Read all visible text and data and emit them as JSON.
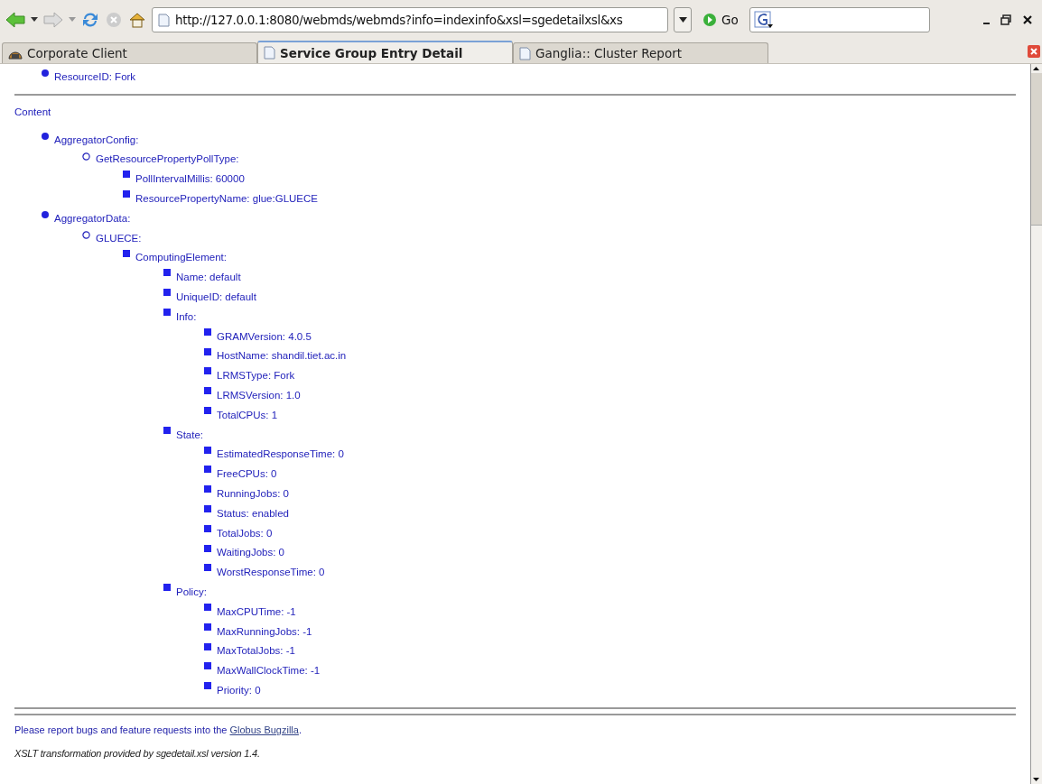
{
  "toolbar": {
    "url": "http://127.0.0.1:8080/webmds/webmds?info=indexinfo&xsl=sgedetailxsl&xs",
    "go": "Go"
  },
  "tabs": [
    {
      "label": "Corporate Client",
      "selected": false
    },
    {
      "label": "Service Group Entry Detail",
      "selected": true
    },
    {
      "label": "Ganglia:: Cluster Report",
      "selected": false
    }
  ],
  "top_items": [
    {
      "text": "ResourceID: Fork"
    }
  ],
  "section_title": "Content",
  "tree": [
    {
      "text": "AggregatorConfig:",
      "children": [
        {
          "text": "GetResourcePropertyPollType:",
          "children": [
            {
              "text": "PollIntervalMillis: 60000"
            },
            {
              "text": "ResourcePropertyName: glue:GLUECE"
            }
          ]
        }
      ]
    },
    {
      "text": "AggregatorData:",
      "children": [
        {
          "text": "GLUECE:",
          "children": [
            {
              "text": "ComputingElement:",
              "children": [
                {
                  "text": "Name: default"
                },
                {
                  "text": "UniqueID: default"
                },
                {
                  "text": "Info:",
                  "children": [
                    {
                      "text": "GRAMVersion: 4.0.5"
                    },
                    {
                      "text": "HostName: shandil.tiet.ac.in"
                    },
                    {
                      "text": "LRMSType: Fork"
                    },
                    {
                      "text": "LRMSVersion: 1.0"
                    },
                    {
                      "text": "TotalCPUs: 1"
                    }
                  ]
                },
                {
                  "text": "State:",
                  "children": [
                    {
                      "text": "EstimatedResponseTime: 0"
                    },
                    {
                      "text": "FreeCPUs: 0"
                    },
                    {
                      "text": "RunningJobs: 0"
                    },
                    {
                      "text": "Status: enabled"
                    },
                    {
                      "text": "TotalJobs: 0"
                    },
                    {
                      "text": "WaitingJobs: 0"
                    },
                    {
                      "text": "WorstResponseTime: 0"
                    }
                  ]
                },
                {
                  "text": "Policy:",
                  "children": [
                    {
                      "text": "MaxCPUTime: -1"
                    },
                    {
                      "text": "MaxRunningJobs: -1"
                    },
                    {
                      "text": "MaxTotalJobs: -1"
                    },
                    {
                      "text": "MaxWallClockTime: -1"
                    },
                    {
                      "text": "Priority: 0"
                    }
                  ]
                }
              ]
            }
          ]
        }
      ]
    }
  ],
  "footer": {
    "before": "Please report bugs and feature requests into the ",
    "link": "Globus Bugzilla",
    "after": ".",
    "note": "XSLT transformation provided by sgedetail.xsl version 1.4."
  }
}
